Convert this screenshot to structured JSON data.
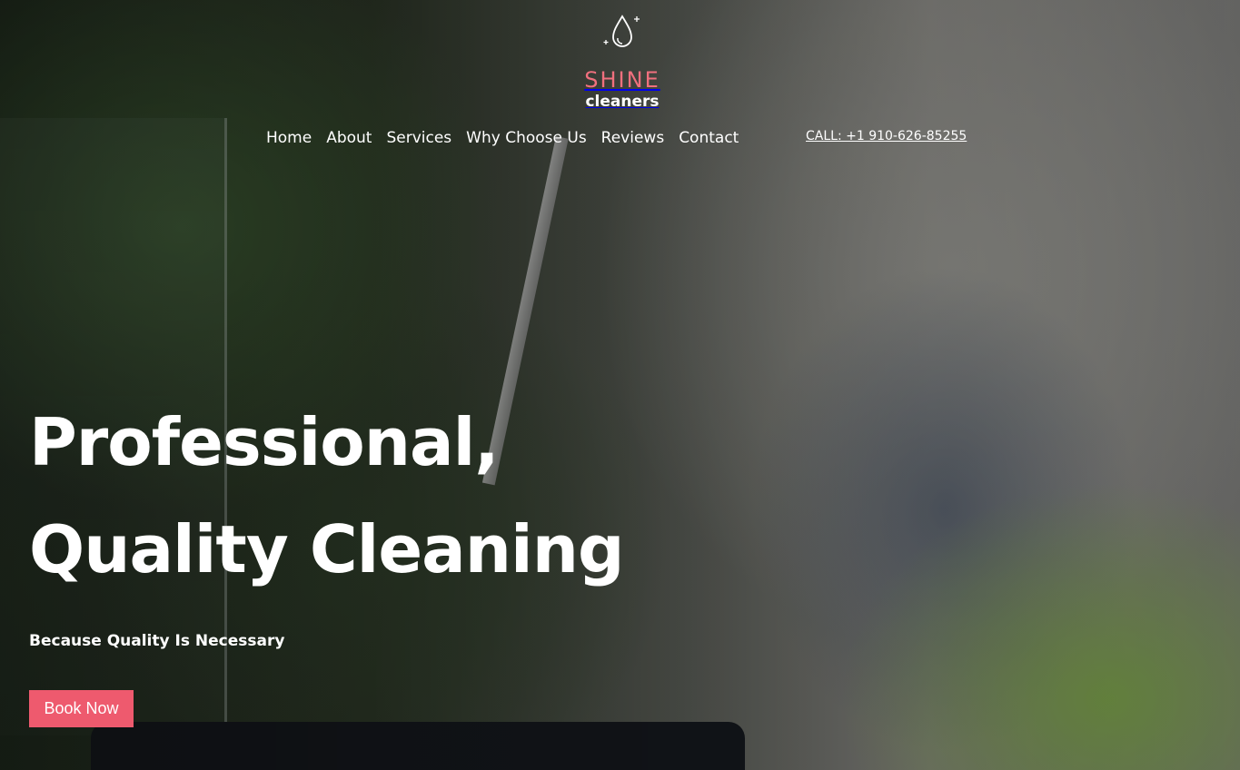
{
  "brand": {
    "name": "SHINE",
    "subtitle": "cleaners",
    "icon": "water-drop-icon",
    "accent_color": "#f0707e"
  },
  "nav": {
    "items": [
      {
        "label": "Home"
      },
      {
        "label": "About"
      },
      {
        "label": "Services"
      },
      {
        "label": "Why Choose Us"
      },
      {
        "label": "Reviews"
      },
      {
        "label": "Contact"
      }
    ],
    "call": "CALL: +1 910-626-85255"
  },
  "hero": {
    "headline_line1": "Professional,",
    "headline_line2": "Quality Cleaning",
    "tagline": "Because Quality Is Necessary",
    "cta_label": "Book Now",
    "cta_color": "#ee5a6e"
  }
}
